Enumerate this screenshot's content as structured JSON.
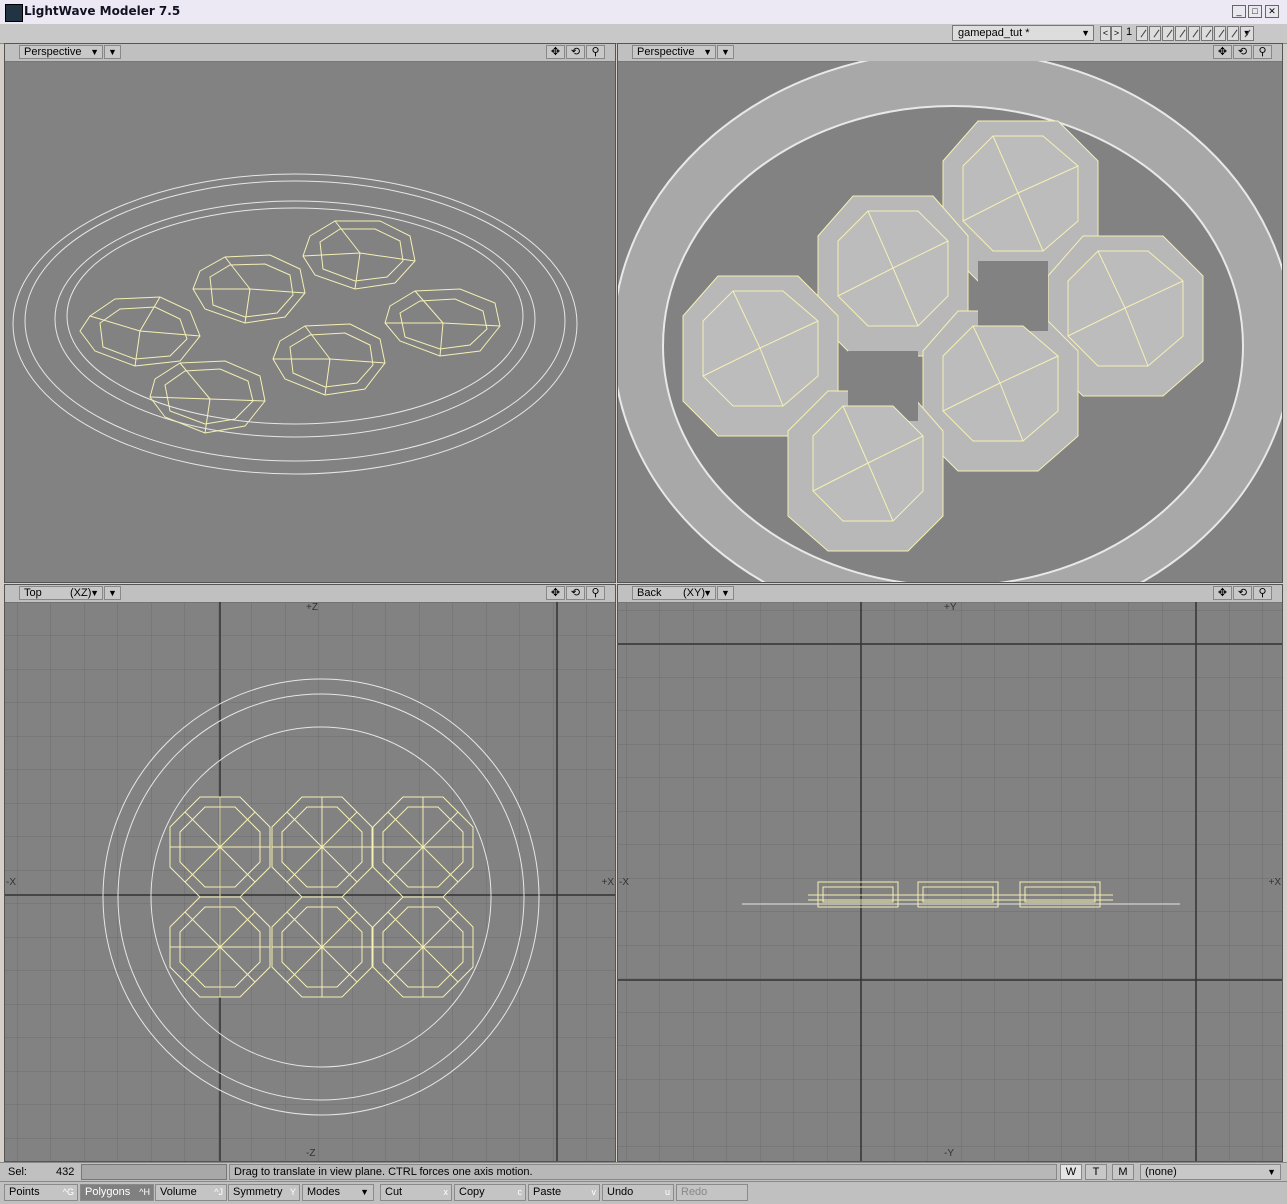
{
  "window": {
    "title": "LightWave Modeler 7.5",
    "min": "_",
    "max": "□",
    "close": "✕"
  },
  "topbar": {
    "object": "gamepad_tut *",
    "layer_number": "1",
    "prev": "<",
    "next": ">"
  },
  "viewports": [
    {
      "mode": "Perspective",
      "axis": ""
    },
    {
      "mode": "Perspective",
      "axis": ""
    },
    {
      "mode": "Top",
      "axis": "(XZ)",
      "labels": {
        "top": "+Z",
        "bottom": "-Z",
        "left": "-X",
        "right": "+X"
      }
    },
    {
      "mode": "Back",
      "axis": "(XY)",
      "labels": {
        "top": "+Y",
        "bottom": "-Y",
        "left": "-X",
        "right": "+X"
      }
    }
  ],
  "status": {
    "sel_label": "Sel:",
    "sel_count": "432",
    "hint": "Drag to translate in view plane. CTRL forces one axis motion.",
    "w": "W",
    "t": "T",
    "m": "M",
    "surface": "(none)"
  },
  "commands": [
    {
      "label": "Points",
      "key": "^G"
    },
    {
      "label": "Polygons",
      "key": "^H"
    },
    {
      "label": "Volume",
      "key": "^J"
    },
    {
      "label": "Symmetry",
      "key": "Y"
    },
    {
      "label": "Modes",
      "key": ""
    },
    {
      "label": "Cut",
      "key": "x"
    },
    {
      "label": "Copy",
      "key": "c"
    },
    {
      "label": "Paste",
      "key": "v"
    },
    {
      "label": "Undo",
      "key": "u"
    },
    {
      "label": "Redo",
      "key": ""
    }
  ],
  "colors": {
    "selected_wire": "#f5f0b4",
    "unselected_wire": "#e6e6e6",
    "viewport_bg": "#828282",
    "grid": "#6e6e6e"
  }
}
